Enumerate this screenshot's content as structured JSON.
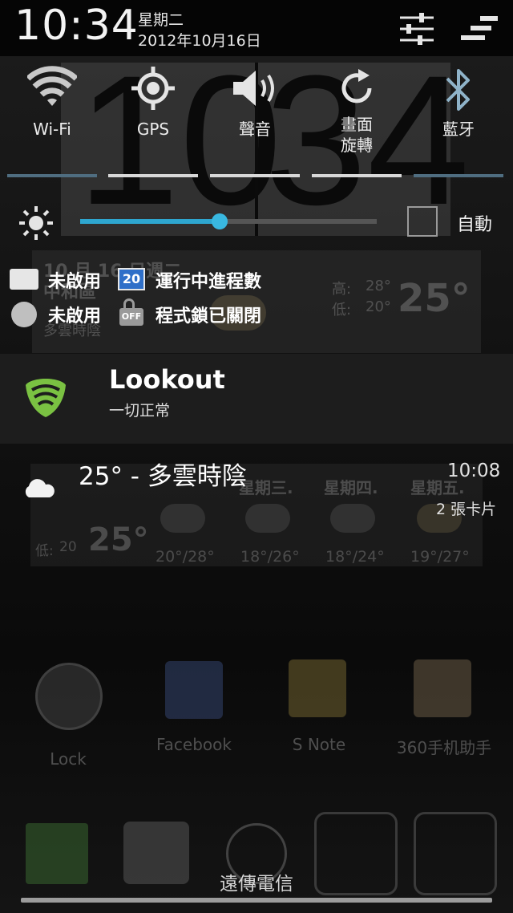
{
  "status_bar": {
    "time": "10:34",
    "weekday": "星期二",
    "date": "2012年10月16日"
  },
  "quick_settings": [
    {
      "label": "Wi-Fi",
      "active": false
    },
    {
      "label": "GPS",
      "active": true
    },
    {
      "label": "聲音",
      "active": true
    },
    {
      "label": "畫面\n旋轉",
      "active": true
    },
    {
      "label": "藍牙",
      "active": false
    }
  ],
  "brightness": {
    "level": 0.47,
    "auto_label": "自動",
    "auto_checked": false
  },
  "status_items": {
    "row1_left": "未啟用",
    "row1_badge": "20",
    "row1_right": "運行中進程數",
    "row2_left": "未啟用",
    "row2_badge": "OFF",
    "row2_right": "程式鎖已關閉"
  },
  "notifications": {
    "lookout": {
      "title": "Lookout",
      "subtitle": "一切正常"
    },
    "weather": {
      "title": "25° - 多雲時陰",
      "time": "10:08",
      "cards": "2 張卡片"
    }
  },
  "background": {
    "clock_digits": [
      "10",
      "34"
    ],
    "widget_date": "10 月 16 日週二",
    "widget_place": "中和區",
    "widget_cond": "多雲時陰",
    "widget_hi_label": "高:",
    "widget_hi": "28°",
    "widget_lo_label": "低:",
    "widget_lo": "20°",
    "widget_temp": "25°",
    "forecast_days": [
      "星期三.",
      "星期四.",
      "星期五."
    ],
    "forecast_ranges": [
      "20°/28°",
      "18°/26°",
      "18°/24°",
      "19°/27°"
    ],
    "forecast_low_label": "低:",
    "forecast_low": "20",
    "forecast_temp": "25°",
    "apps": [
      "Lock",
      "Facebook",
      "S Note",
      "360手机助手"
    ],
    "carrier": "遠傳電信"
  },
  "colors": {
    "accent": "#2ea6cf",
    "active_bar": "#d8d8d8",
    "inactive_bar": "#4f6d80"
  }
}
